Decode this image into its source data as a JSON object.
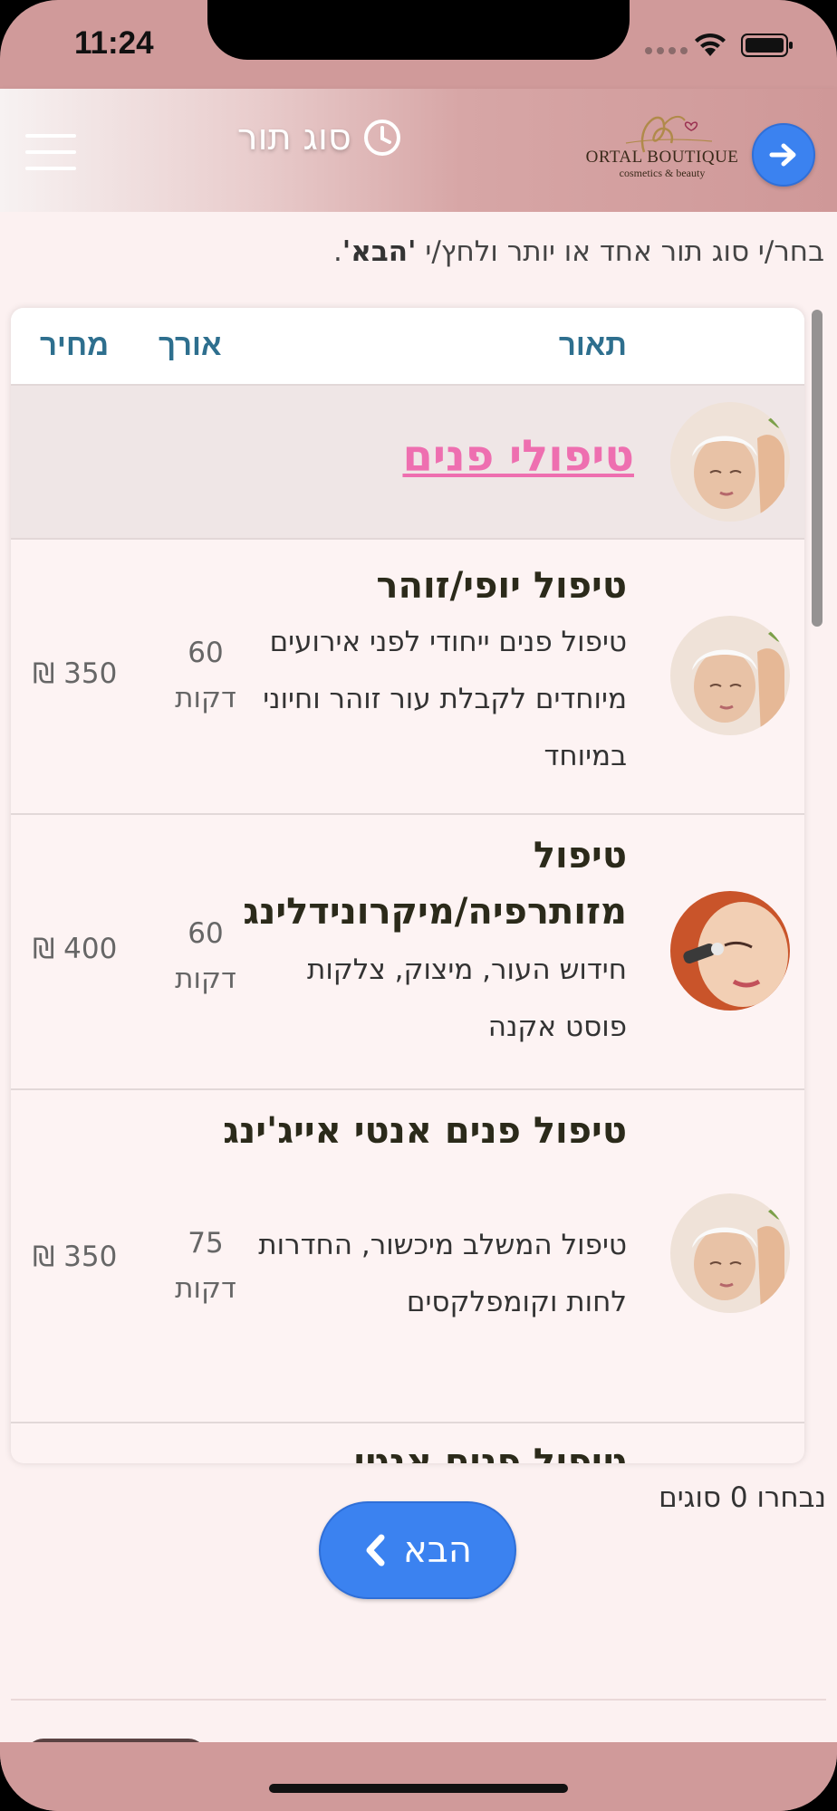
{
  "status": {
    "time": "11:24"
  },
  "header": {
    "title": "סוג תור",
    "logo_name": "ORTAL BOUTIQUE",
    "logo_sub": "cosmetics & beauty"
  },
  "instructions": {
    "text_before": "בחר/י סוג תור אחד או יותר ולחץ/י ",
    "bold": "'הבא'",
    "text_after": "."
  },
  "table": {
    "headers": {
      "description": "תאור",
      "length": "אורך",
      "price": "מחיר"
    },
    "category": "טיפולי פנים",
    "rows": [
      {
        "title": "טיפול יופי/זוהר",
        "description": "טיפול פנים ייחודי לפני אירועים מיוחדים לקבלת עור זוהר וחיוני במיוחד",
        "length": "60 דקות",
        "price": "350 ₪"
      },
      {
        "title": "טיפול מזותרפיה/מיקרונידלינג",
        "description": "חידוש העור, מיצוק, צלקות פוסט אקנה",
        "length": "60 דקות",
        "price": "400 ₪"
      },
      {
        "title": "טיפול פנים אנטי אייג'ינג",
        "description": "טיפול המשלב מיכשור, החדרות לחות וקומפלקסים",
        "length": "75 דקות",
        "price": "350 ₪"
      },
      {
        "title": "טיפול פנים אנטי",
        "description": "",
        "length": "",
        "price": ""
      }
    ]
  },
  "footer": {
    "selected_count": "נבחרו 0 סוגים",
    "next_label": "הבא"
  },
  "colors": {
    "accent": "#3b82f0",
    "brand": "#d09a9a",
    "category": "#ee6fb0",
    "header_text": "#2e6f8e"
  }
}
